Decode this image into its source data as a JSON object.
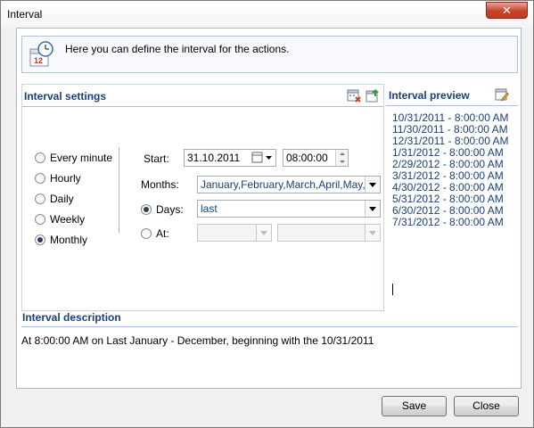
{
  "window": {
    "title": "Interval",
    "close_glyph": "✕"
  },
  "info": {
    "text": "Here you can define the interval for the actions.",
    "icon": "calendar-clock-icon"
  },
  "settings": {
    "title": "Interval settings",
    "radios": [
      {
        "label": "Every minute",
        "checked": false
      },
      {
        "label": "Hourly",
        "checked": false
      },
      {
        "label": "Daily",
        "checked": false
      },
      {
        "label": "Weekly",
        "checked": false
      },
      {
        "label": "Monthly",
        "checked": true
      }
    ],
    "start": {
      "label": "Start:",
      "date": "31.10.2011",
      "time": "08:00:00"
    },
    "months": {
      "label": "Months:",
      "value": "January,February,March,April,May,J"
    },
    "days": {
      "label": "Days:",
      "value": "last",
      "checked": true
    },
    "at": {
      "label": "At:",
      "value1": "",
      "value2": "",
      "checked": false
    }
  },
  "preview": {
    "title": "Interval preview",
    "items": [
      "10/31/2011 - 8:00:00 AM",
      "11/30/2011 - 8:00:00 AM",
      "12/31/2011 - 8:00:00 AM",
      "1/31/2012 - 8:00:00 AM",
      "2/29/2012 - 8:00:00 AM",
      "3/31/2012 - 8:00:00 AM",
      "4/30/2012 - 8:00:00 AM",
      "5/31/2012 - 8:00:00 AM",
      "6/30/2012 - 8:00:00 AM",
      "7/31/2012 - 8:00:00 AM"
    ]
  },
  "description": {
    "title": "Interval description",
    "text": "At 8:00:00 AM on Last January - December, beginning with the 10/31/2011"
  },
  "buttons": {
    "save": "Save",
    "close": "Close"
  },
  "colors": {
    "accent": "#1b3f7b",
    "border": "#a9c1df",
    "close": "#c7432a"
  }
}
